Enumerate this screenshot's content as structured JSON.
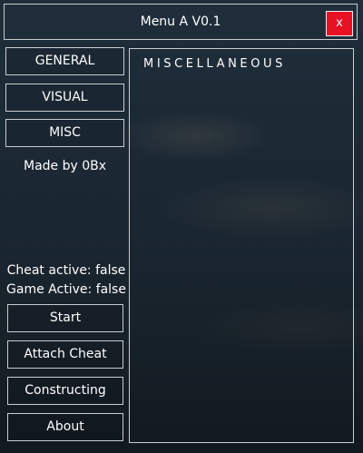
{
  "window": {
    "title": "Menu A V0.1",
    "close_label": "x"
  },
  "nav": {
    "items": [
      {
        "label": "GENERAL"
      },
      {
        "label": "VISUAL"
      },
      {
        "label": "MISC"
      }
    ]
  },
  "credit": "Made by 0Bx",
  "status": {
    "cheat_active": "Cheat active: false",
    "game_active": "Game Active: false"
  },
  "actions": {
    "start": "Start",
    "attach": "Attach Cheat",
    "constructing": "Constructing",
    "about": "About"
  },
  "panel": {
    "title": "MISCELLANEOUS"
  },
  "colors": {
    "close_button": "#e81123",
    "border": "#c8ccd0",
    "text": "#ffffff"
  }
}
